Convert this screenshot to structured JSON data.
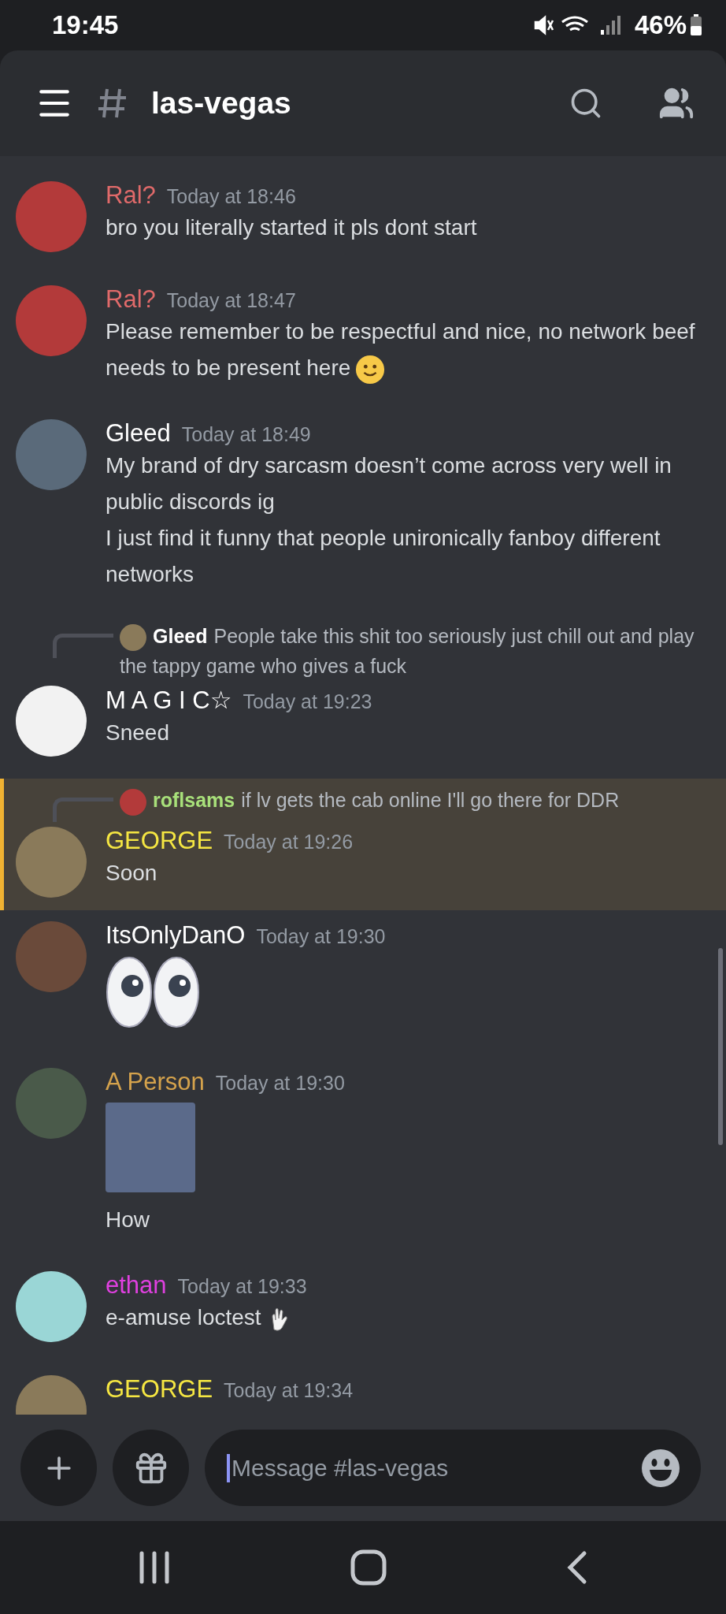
{
  "status_bar": {
    "time": "19:45",
    "battery": "46%"
  },
  "header": {
    "channel": "las-vegas"
  },
  "messages": [
    {
      "kind": "text",
      "author": "Ral?",
      "color": "#e06a6a",
      "time": "Today at 18:46",
      "paragraphs": [
        "bro you literally started it pls dont start"
      ],
      "highlighted": false
    },
    {
      "kind": "text_with_emoji",
      "author": "Ral?",
      "color": "#e06a6a",
      "time": "Today at 18:47",
      "paragraphs": [
        "Please remember to be respectful and nice, no network beef needs to be present here"
      ],
      "highlighted": false
    },
    {
      "kind": "text",
      "author": "Gleed",
      "color": "#ffffff",
      "time": "Today at 18:49",
      "paragraphs": [
        "My brand of dry sarcasm doesn’t come across very well in public discords ig",
        "I just find it funny that people unironically fanboy different networks"
      ],
      "highlighted": false
    },
    {
      "kind": "text",
      "author": "M A G I C☆",
      "color": "#ffffff",
      "time": "Today at 19:23",
      "paragraphs": [
        "Sneed"
      ],
      "highlighted": false,
      "reply": {
        "author": "Gleed",
        "color": "#ffffff",
        "text": "People take this shit too seriously just chill out and play the tappy game who gives a fuck"
      }
    },
    {
      "kind": "text",
      "author": "GEORGE",
      "color": "#f5e642",
      "time": "Today at 19:26",
      "paragraphs": [
        "Soon"
      ],
      "highlighted": true,
      "reply": {
        "author": "roflsams",
        "color": "#a8e07a",
        "text": "if lv gets the cab online I'll go there for DDR"
      }
    },
    {
      "kind": "emoji_only",
      "author": "ItsOnlyDanO",
      "color": "#ffffff",
      "time": "Today at 19:30",
      "highlighted": false
    },
    {
      "kind": "image_then_text",
      "author": "A Person",
      "color": "#d4a24c",
      "time": "Today at 19:30",
      "paragraphs": [
        "How"
      ],
      "highlighted": false
    },
    {
      "kind": "text_with_emoji",
      "author": "ethan",
      "color": "#e040e0",
      "time": "Today at 19:33",
      "paragraphs": [
        "e-amuse loctest"
      ],
      "highlighted": false
    },
    {
      "kind": "text",
      "author": "GEORGE",
      "color": "#f5e642",
      "time": "Today at 19:34",
      "highlighted": false
    }
  ],
  "composer": {
    "placeholder": "Message #las-vegas"
  }
}
